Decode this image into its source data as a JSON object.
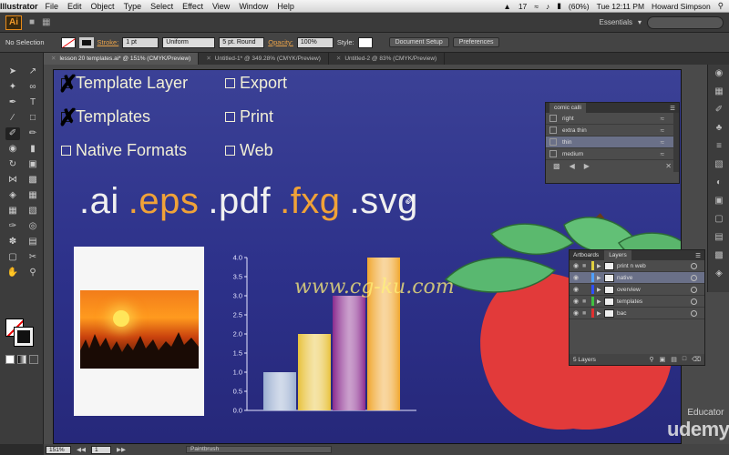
{
  "menubar": {
    "app_name": "Illustrator",
    "items": [
      "File",
      "Edit",
      "Object",
      "Type",
      "Select",
      "Effect",
      "View",
      "Window",
      "Help"
    ],
    "badge_number": "17",
    "battery": "(60%)",
    "clock": "Tue 12:11 PM",
    "user": "Howard Simpson"
  },
  "appbar": {
    "logo": "Ai",
    "workspace": "Essentials"
  },
  "control": {
    "selection": "No Selection",
    "stroke_label": "Stroke:",
    "stroke_value": "1 pt",
    "profile": "Uniform",
    "brush": "5 pt. Round",
    "opacity_label": "Opacity:",
    "opacity_value": "100%",
    "style_label": "Style:",
    "doc_setup": "Document Setup",
    "preferences": "Preferences"
  },
  "tabs": [
    "lesson 20 templates.ai* @ 151% (CMYK/Preview)",
    "Untitled-1* @ 349.28% (CMYK/Preview)",
    "Untitled-2 @ 83% (CMYK/Preview)"
  ],
  "artboard": {
    "checklist": [
      {
        "label": "Template Layer",
        "checked": true
      },
      {
        "label": "Templates",
        "checked": true
      },
      {
        "label": "Native Formats",
        "checked": false
      },
      {
        "label": "Export",
        "checked": false
      },
      {
        "label": "Print",
        "checked": false
      },
      {
        "label": "Web",
        "checked": false
      }
    ],
    "formats": [
      {
        "text": ".ai",
        "color": "#f0f0f0"
      },
      {
        "text": ".eps",
        "color": "#f0a238"
      },
      {
        "text": ".pdf",
        "color": "#f0f0f0"
      },
      {
        "text": ".fxg",
        "color": "#f0a238"
      },
      {
        "text": ".svg",
        "color": "#f0f0f0"
      }
    ]
  },
  "chart_data": {
    "type": "bar",
    "categories": [
      "1",
      "2",
      "3",
      "4"
    ],
    "values": [
      1.0,
      2.0,
      3.0,
      4.0
    ],
    "yticks": [
      "0.0",
      "0.5",
      "1.0",
      "1.5",
      "2.0",
      "2.5",
      "3.0",
      "3.5",
      "4.0"
    ],
    "ylim": [
      0,
      4
    ],
    "colors": [
      "#9aaed0",
      "#e8c23c",
      "#8a2a8e",
      "#f0a62e"
    ]
  },
  "brushes_panel": {
    "title": "comic calli",
    "items": [
      "right",
      "extra thin",
      "thin",
      "medium"
    ],
    "selected": "thin"
  },
  "layers_panel": {
    "tab_artboards": "Artboards",
    "tab_layers": "Layers",
    "layers": [
      {
        "name": "print n web",
        "color": "#e0d040"
      },
      {
        "name": "native",
        "color": "#50a0ff"
      },
      {
        "name": "overview",
        "color": "#3050ff"
      },
      {
        "name": "templates",
        "color": "#40c040"
      },
      {
        "name": "bac",
        "color": "#e03030"
      }
    ],
    "selected": "native",
    "count_text": "5 Layers"
  },
  "status": {
    "zoom": "151%",
    "page": "1",
    "tool": "Paintbrush"
  },
  "watermarks": {
    "site": "www.cg-ku.com",
    "educator": "Educator",
    "brand": "udemy"
  }
}
